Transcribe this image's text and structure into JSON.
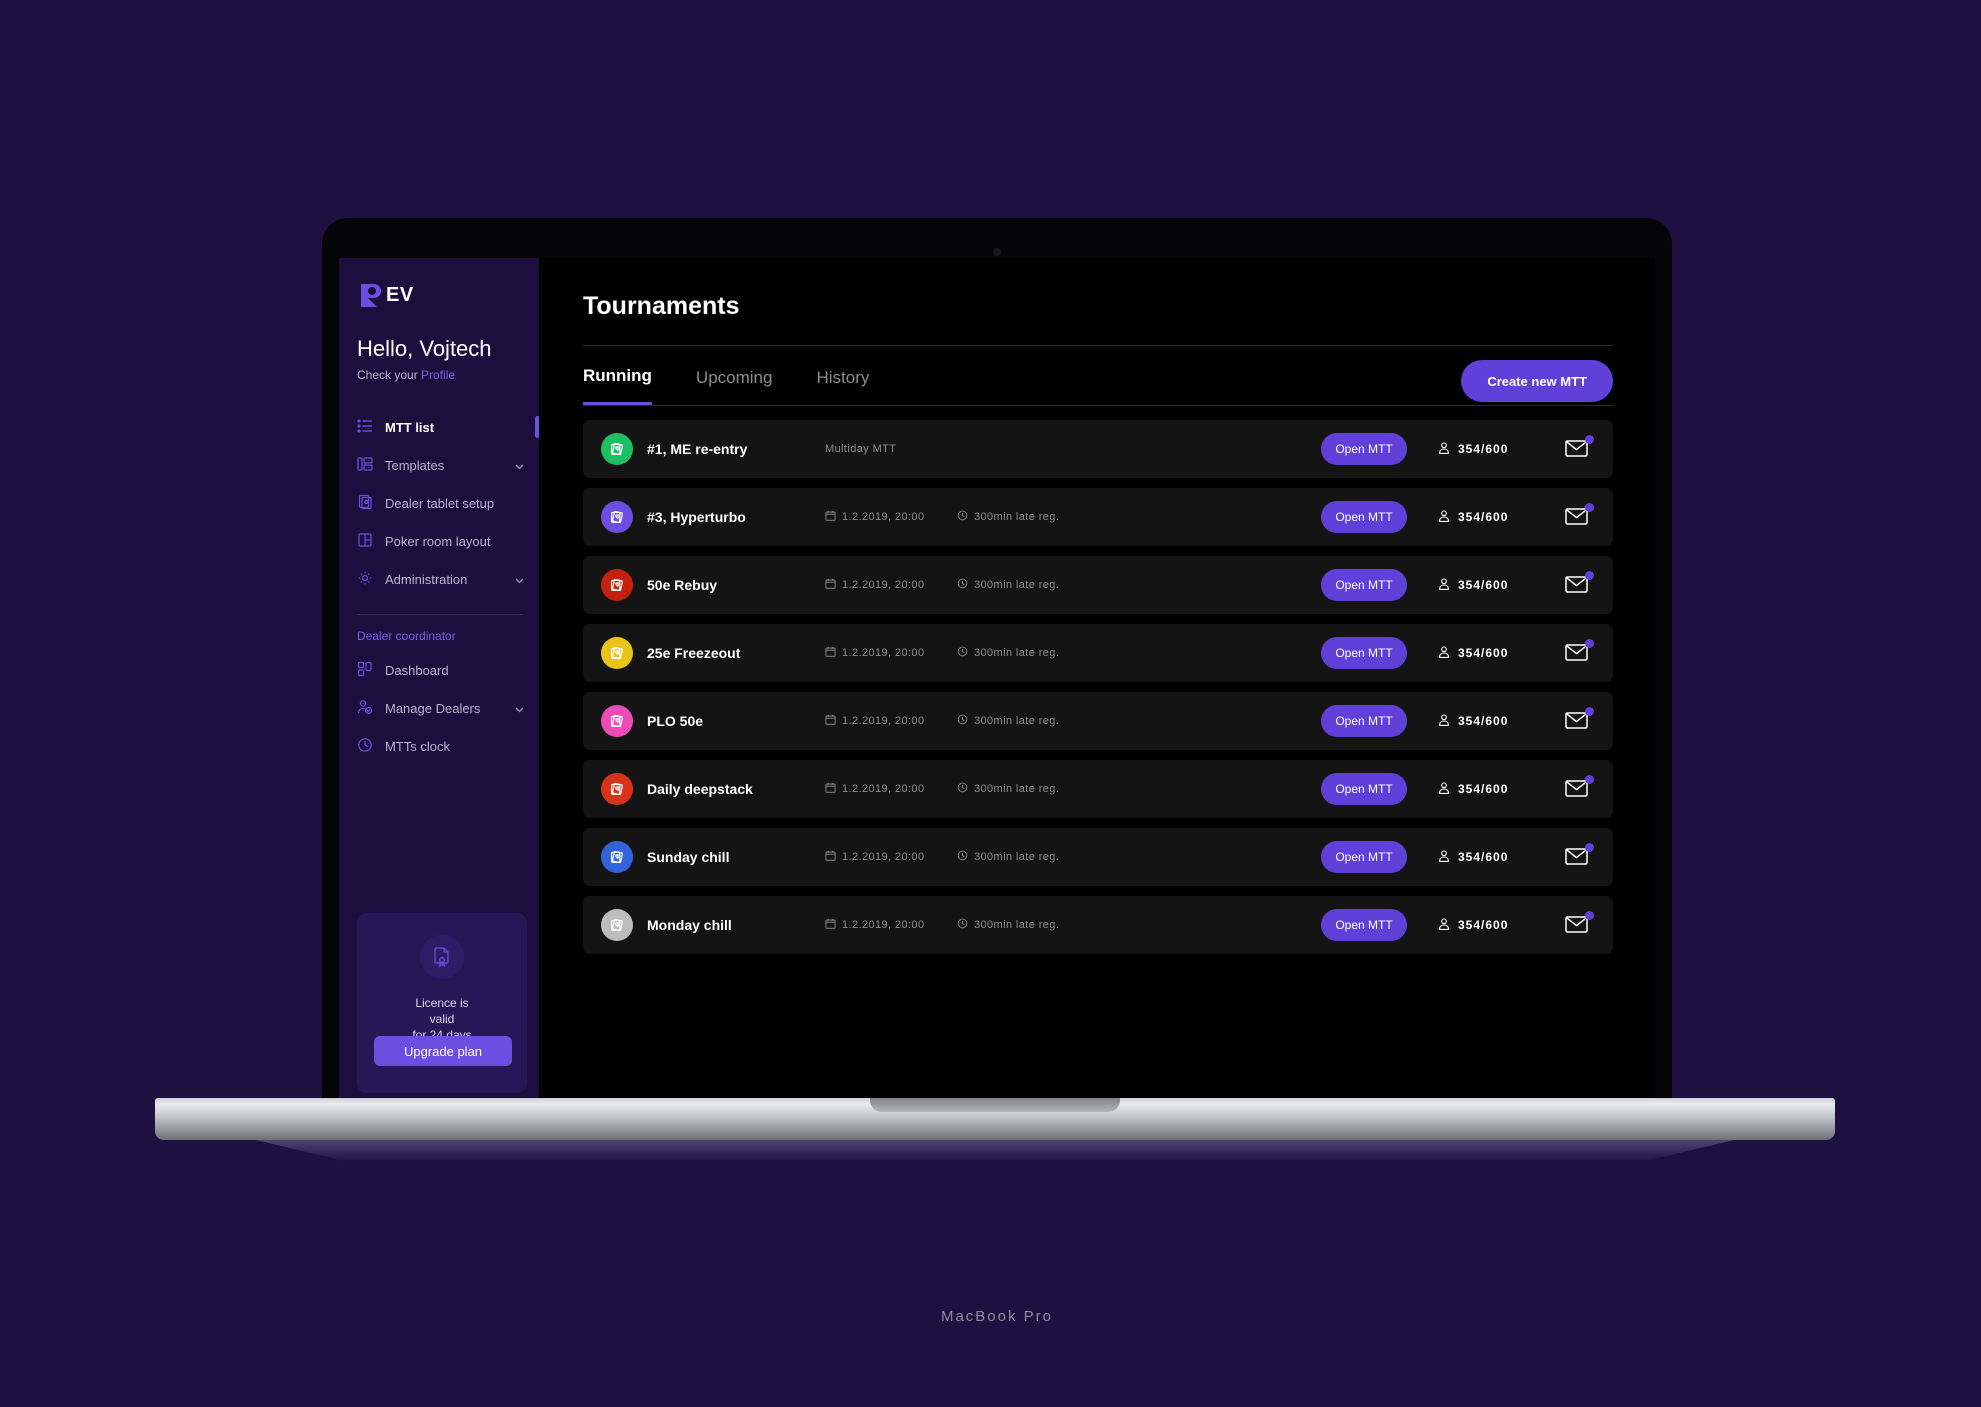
{
  "device": {
    "model_label": "MacBook Pro"
  },
  "brand": {
    "name": "EV",
    "logo_icon": "rev-logo-icon"
  },
  "sidebar": {
    "greeting": "Hello, Vojtech",
    "check_prefix": "Check your ",
    "profile_link": "Profile",
    "nav": [
      {
        "label": "MTT list",
        "icon": "list-icon",
        "active": true,
        "chevron": false
      },
      {
        "label": "Templates",
        "icon": "templates-icon",
        "active": false,
        "chevron": true
      },
      {
        "label": "Dealer tablet setup",
        "icon": "tablet-icon",
        "active": false,
        "chevron": false
      },
      {
        "label": "Poker room layout",
        "icon": "layout-icon",
        "active": false,
        "chevron": false
      },
      {
        "label": "Administration",
        "icon": "gear-icon",
        "active": false,
        "chevron": true
      }
    ],
    "section_title": "Dealer coordinator",
    "nav2": [
      {
        "label": "Dashboard",
        "icon": "dashboard-icon",
        "active": false,
        "chevron": false
      },
      {
        "label": "Manage Dealers",
        "icon": "user-check-icon",
        "active": false,
        "chevron": true
      },
      {
        "label": "MTTs clock",
        "icon": "clock-icon",
        "active": false,
        "chevron": false
      }
    ],
    "licence": {
      "icon": "certificate-icon",
      "line1": "Licence is",
      "line2": "valid",
      "line3": "for 24 days",
      "button": "Upgrade plan"
    }
  },
  "main": {
    "page_title": "Tournaments",
    "tabs": [
      {
        "label": "Running",
        "active": true
      },
      {
        "label": "Upcoming",
        "active": false
      },
      {
        "label": "History",
        "active": false
      }
    ],
    "create_button": "Create new MTT",
    "row_defaults": {
      "open_label": "Open MTT",
      "players_icon": "players-icon",
      "mail_icon": "envelope-icon",
      "calendar_icon": "calendar-icon",
      "clock_icon": "clock-icon",
      "chip_icon": "poker-chip-icon"
    },
    "tournaments": [
      {
        "name": "#1, ME re-entry",
        "avatar_color": "#1dbf62",
        "badge": "Multiday MTT",
        "datetime": "",
        "late_reg": "",
        "open_label": "Open MTT",
        "players": "354/600"
      },
      {
        "name": "#3, Hyperturbo",
        "avatar_color": "#6c4fe0",
        "badge": "",
        "datetime": "1.2.2019, 20:00",
        "late_reg": "300min late reg.",
        "open_label": "Open MTT",
        "players": "354/600"
      },
      {
        "name": "50e Rebuy",
        "avatar_color": "#c3200f",
        "badge": "",
        "datetime": "1.2.2019, 20:00",
        "late_reg": "300min late reg.",
        "open_label": "Open MTT",
        "players": "354/600"
      },
      {
        "name": "25e Freezeout",
        "avatar_color": "#e8c516",
        "badge": "",
        "datetime": "1.2.2019, 20:00",
        "late_reg": "300min late reg.",
        "open_label": "Open MTT",
        "players": "354/600"
      },
      {
        "name": "PLO 50e",
        "avatar_color": "#f martin",
        "badge": "",
        "datetime": "1.2.2019, 20:00",
        "late_reg": "300min late reg.",
        "open_label": "Open MTT",
        "players": "354/600"
      },
      {
        "name": "Daily deepstack",
        "avatar_color": "#d8331a",
        "badge": "",
        "datetime": "1.2.2019, 20:00",
        "late_reg": "300min late reg.",
        "open_label": "Open MTT",
        "players": "354/600"
      },
      {
        "name": "Sunday chill",
        "avatar_color": "#3363da",
        "badge": "",
        "datetime": "1.2.2019, 20:00",
        "late_reg": "300min late reg.",
        "open_label": "Open MTT",
        "players": "354/600"
      },
      {
        "name": "Monday chill",
        "avatar_color": "#bdbdbd",
        "badge": "",
        "datetime": "1.2.2019, 20:00",
        "late_reg": "300min late reg.",
        "open_label": "Open MTT",
        "players": "354/600"
      }
    ]
  },
  "colors": {
    "page_background": "#1e1040",
    "sidebar_background": "#1a0f3d",
    "content_background": "#000000",
    "accent": "#6c4fe0",
    "row_background": "#141414"
  }
}
